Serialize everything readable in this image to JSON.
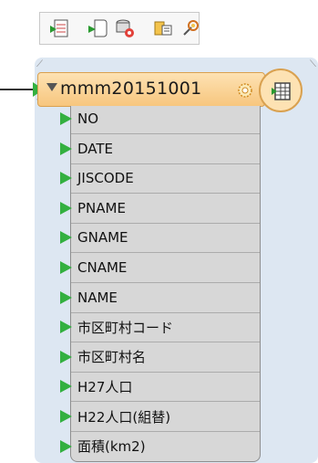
{
  "node": {
    "name": "mmm20151001",
    "attributes": [
      "NO",
      "DATE",
      "JISCODE",
      "PNAME",
      "GNAME",
      "CNAME",
      "NAME",
      "市区町村コード",
      "市区町村名",
      "H27人口",
      "H22人口(組替)",
      "面積(km2)"
    ]
  },
  "toolbar": {
    "buttons": [
      "add-input-icon",
      "add-output-icon",
      "db-settings-icon",
      "navigator-icon",
      "feature-types-icon"
    ]
  },
  "colors": {
    "port_green": "#33b040",
    "header_fill": "#f7c67e",
    "canvas_bg": "#dde7f2"
  }
}
